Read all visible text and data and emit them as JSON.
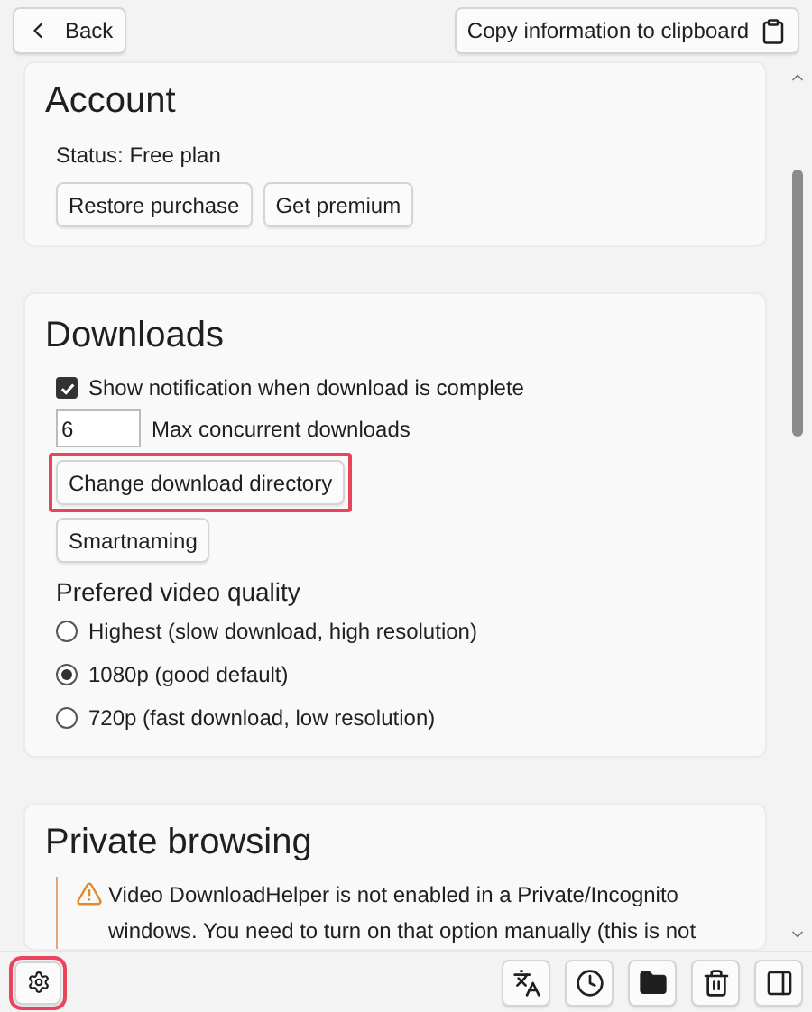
{
  "top_bar": {
    "back_button": "Back",
    "copy_button": "Copy information to clipboard"
  },
  "account": {
    "title": "Account",
    "status": "Status: Free plan",
    "buttons": [
      {
        "label": "Restore purchase",
        "highlighted": false
      },
      {
        "label": "Get premium",
        "highlighted": false
      }
    ]
  },
  "downloads": {
    "title": "Downloads",
    "notify": {
      "label": "Show notification when download is complete",
      "checked": true
    },
    "max_concurrent": {
      "value": "6",
      "label": "Max concurrent downloads"
    },
    "buttons": [
      {
        "label": "Change download directory",
        "highlighted": true
      },
      {
        "label": "Smartnaming",
        "highlighted": false
      }
    ],
    "quality": {
      "title": "Prefered video quality",
      "options": [
        {
          "label": "Highest (slow download, high resolution)",
          "selected": false
        },
        {
          "label": "1080p (good default)",
          "selected": true
        },
        {
          "label": "720p (fast download, low resolution)",
          "selected": false
        }
      ]
    }
  },
  "private_browsing": {
    "title": "Private browsing",
    "warning_lines": [
      "Video DownloadHelper is not enabled in a Private/Incognito",
      "windows. You need to turn on that option manually (this is not"
    ]
  },
  "bottom_bar": {
    "settings_highlighted": true,
    "tools": [
      {
        "kind": "translate"
      },
      {
        "kind": "history"
      },
      {
        "kind": "folder"
      },
      {
        "kind": "trash"
      },
      {
        "kind": "sidebar"
      }
    ]
  }
}
